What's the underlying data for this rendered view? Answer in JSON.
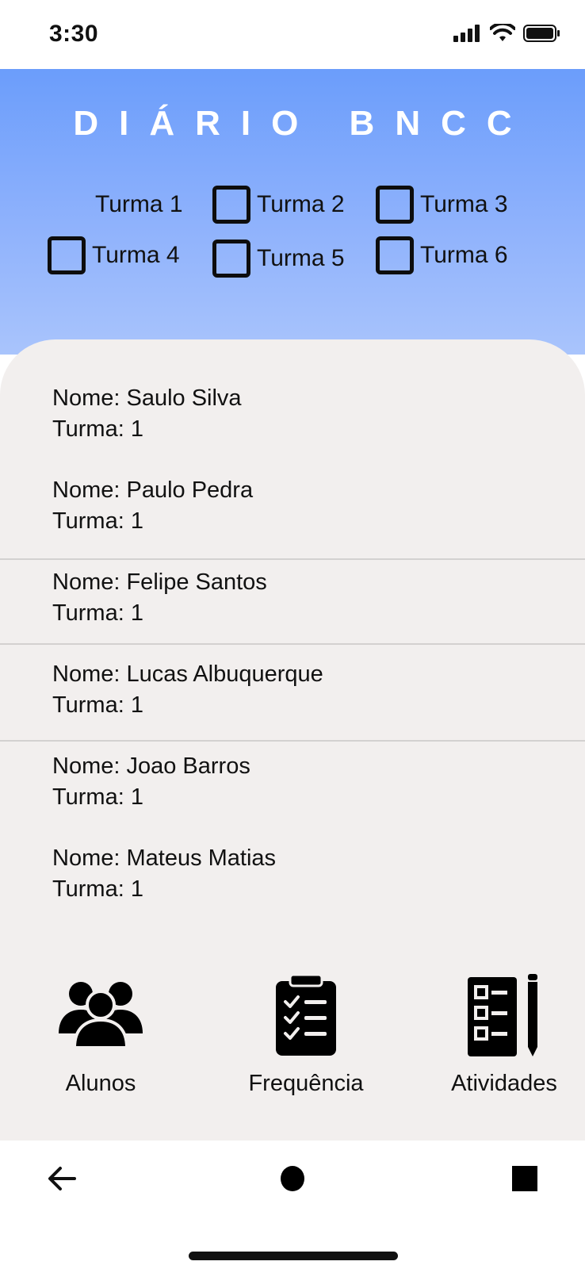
{
  "status_bar": {
    "time": "3:30"
  },
  "header": {
    "title": "DIÁRIO BNCC"
  },
  "classes": [
    {
      "label": "Turma 1",
      "checkbox": false
    },
    {
      "label": "Turma 2",
      "checkbox": true
    },
    {
      "label": "Turma 3",
      "checkbox": true
    },
    {
      "label": "Turma 4",
      "checkbox": true
    },
    {
      "label": "Turma 5",
      "checkbox": true
    },
    {
      "label": "Turma 6",
      "checkbox": true
    }
  ],
  "students": [
    {
      "name": "Nome: Saulo Silva",
      "class": "Turma: 1"
    },
    {
      "name": "Nome: Paulo Pedra",
      "class": "Turma: 1"
    },
    {
      "name": "Nome: Felipe Santos",
      "class": "Turma: 1"
    },
    {
      "name": "Nome: Lucas Albuquerque",
      "class": "Turma: 1"
    },
    {
      "name": "Nome: Joao Barros",
      "class": "Turma: 1"
    },
    {
      "name": "Nome: Mateus Matias",
      "class": "Turma: 1"
    }
  ],
  "bottom_nav": [
    {
      "label": "Alunos",
      "icon": "students-group-icon"
    },
    {
      "label": "Frequência",
      "icon": "clipboard-checklist-icon"
    },
    {
      "label": "Atividades",
      "icon": "activities-list-pencil-icon"
    }
  ],
  "system_nav": {
    "back_icon": "back-arrow-icon",
    "home_icon": "home-circle-icon",
    "recents_icon": "recents-square-icon"
  },
  "colors": {
    "header_gradient_top": "#6b9dfb",
    "header_gradient_bottom": "#a9c4fc",
    "panel_background": "#f2efee",
    "title_text": "#ffffff"
  }
}
